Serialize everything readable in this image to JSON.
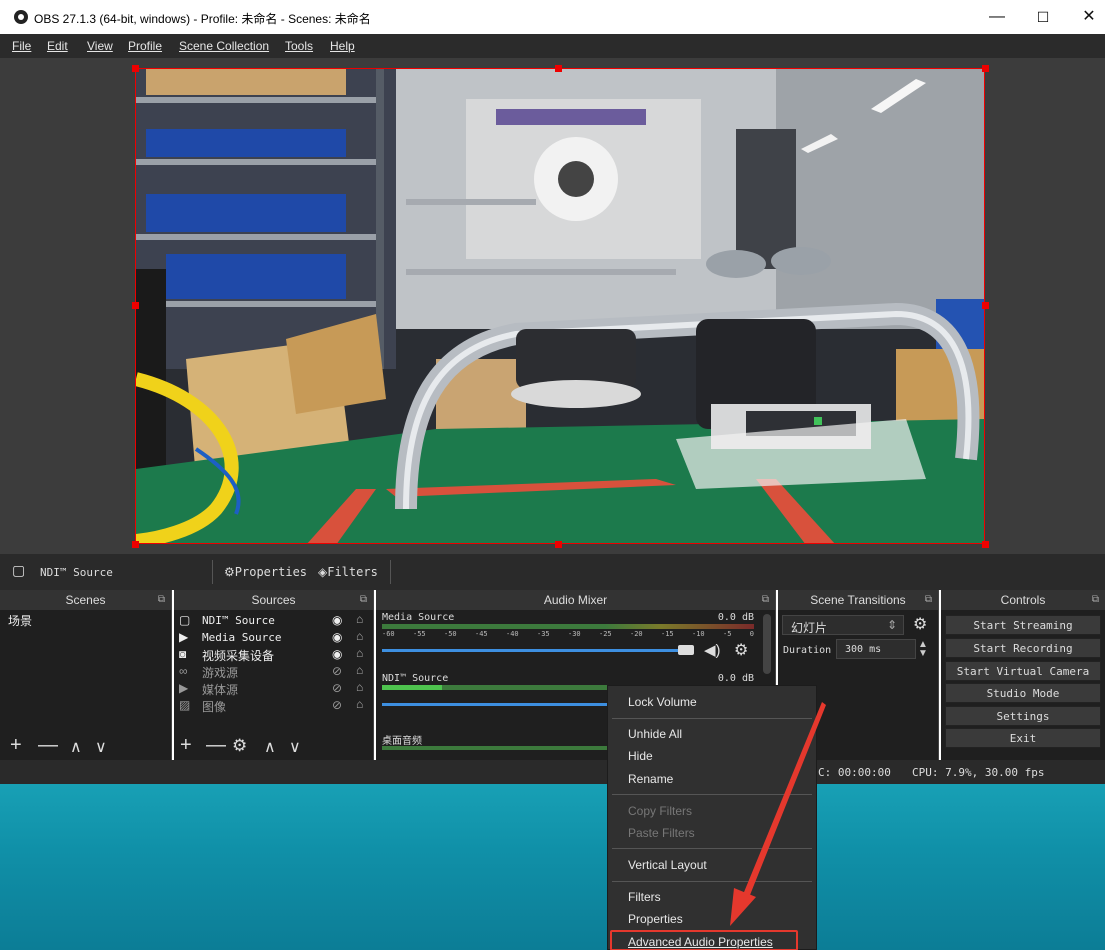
{
  "window": {
    "title": "OBS 27.1.3 (64-bit, windows) - Profile: 未命名 - Scenes: 未命名",
    "minimize": "—",
    "maximize": "☐",
    "close": "✕"
  },
  "menu": [
    "File",
    "Edit",
    "View",
    "Profile",
    "Scene Collection",
    "Tools",
    "Help"
  ],
  "source_toolbar": {
    "current_source": "NDI™ Source",
    "properties": "Properties",
    "filters": "Filters"
  },
  "scenes": {
    "title": "Scenes",
    "items": [
      "场景"
    ]
  },
  "sources": {
    "title": "Sources",
    "items": [
      {
        "name": "NDI™ Source",
        "icon": "video-icon",
        "visible": true
      },
      {
        "name": "Media Source",
        "icon": "play-icon",
        "visible": true
      },
      {
        "name": "视频采集设备",
        "icon": "camera-icon",
        "visible": true
      },
      {
        "name": "游戏源",
        "icon": "gamepad-icon",
        "visible": false
      },
      {
        "name": "媒体源",
        "icon": "play-icon",
        "visible": false
      },
      {
        "name": "图像",
        "icon": "image-icon",
        "visible": false
      }
    ]
  },
  "audio_mixer": {
    "title": "Audio Mixer",
    "channels": [
      {
        "name": "Media Source",
        "db": "0.0 dB"
      },
      {
        "name": "NDI™ Source",
        "db": "0.0 dB"
      },
      {
        "name": "桌面音频",
        "db": ""
      }
    ],
    "scale_labels": [
      "-60",
      "-55",
      "-50",
      "-45",
      "-40",
      "-35",
      "-30",
      "-25",
      "-20",
      "-15",
      "-10",
      "-5",
      "0"
    ]
  },
  "scene_transitions": {
    "title": "Scene Transitions",
    "transition": "幻灯片",
    "duration_label": "Duration",
    "duration_value": "300 ms"
  },
  "controls": {
    "title": "Controls",
    "buttons": [
      "Start Streaming",
      "Start Recording",
      "Start Virtual Camera",
      "Studio Mode",
      "Settings",
      "Exit"
    ]
  },
  "status": {
    "rec": "C: 00:00:00",
    "cpu": "CPU: 7.9%, 30.00 fps"
  },
  "context_menu": {
    "items": [
      {
        "label": "Lock Volume",
        "enabled": true
      },
      {
        "label": "Unhide All",
        "enabled": true
      },
      {
        "label": "Hide",
        "enabled": true
      },
      {
        "label": "Rename",
        "enabled": true
      },
      {
        "label": "Copy Filters",
        "enabled": false
      },
      {
        "label": "Paste Filters",
        "enabled": false
      },
      {
        "label": "Vertical Layout",
        "enabled": true
      },
      {
        "label": "Filters",
        "enabled": true
      },
      {
        "label": "Properties",
        "enabled": true
      },
      {
        "label": "Advanced Audio Properties",
        "enabled": true,
        "highlighted": true
      }
    ]
  },
  "colors": {
    "accent_red": "#e5382d",
    "meter_green": "#4ec34e",
    "slider_blue": "#3d8fe0"
  }
}
